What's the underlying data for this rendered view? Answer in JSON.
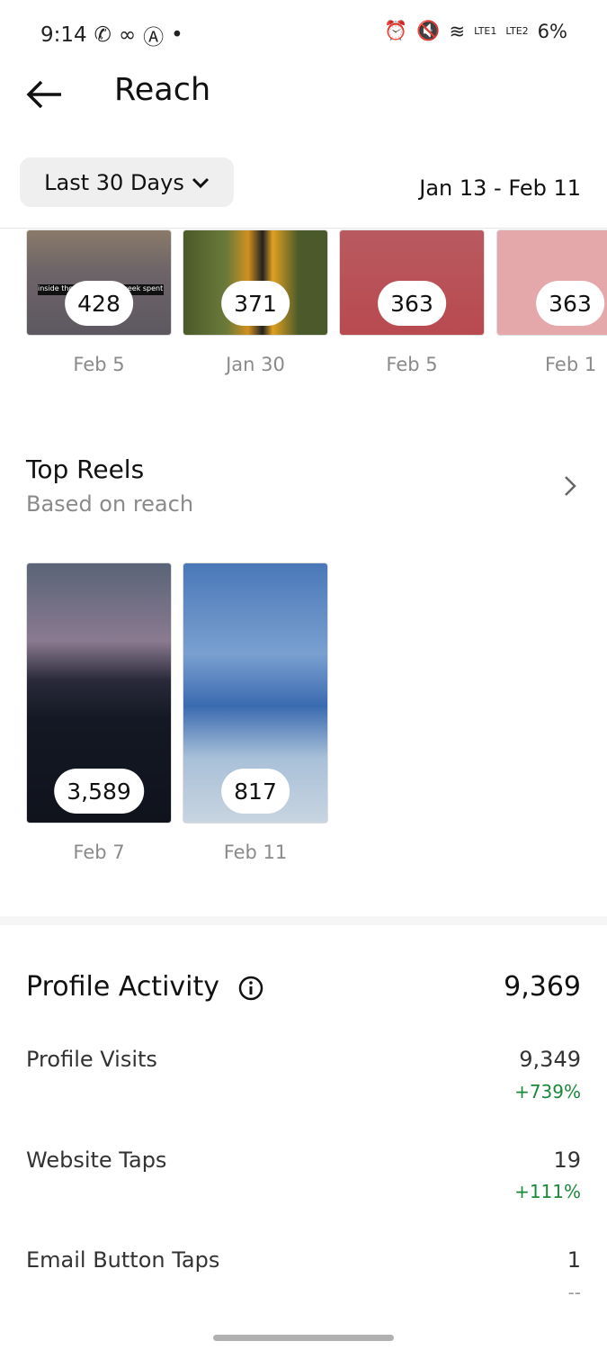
{
  "status_bar": {
    "time": "9:14",
    "battery": "6%",
    "network1": "LTE1",
    "network2": "LTE2"
  },
  "header": {
    "title": "Reach"
  },
  "filter": {
    "selected": "Last 30 Days",
    "date_range": "Jan 13 - Feb 11"
  },
  "top_posts": [
    {
      "value": "428",
      "date": "Feb 5",
      "caption": "inside thoughts after a week spent in hospitals ... the house"
    },
    {
      "value": "371",
      "date": "Jan 30"
    },
    {
      "value": "363",
      "date": "Feb 5"
    },
    {
      "value": "363",
      "date": "Feb 1"
    }
  ],
  "top_reels": {
    "title": "Top Reels",
    "subtitle": "Based on reach",
    "items": [
      {
        "value": "3,589",
        "date": "Feb 7"
      },
      {
        "value": "817",
        "date": "Feb 11"
      }
    ]
  },
  "profile_activity": {
    "title": "Profile Activity",
    "total": "9,369",
    "rows": [
      {
        "label": "Profile Visits",
        "value": "9,349",
        "change": "+739%"
      },
      {
        "label": "Website Taps",
        "value": "19",
        "change": "+111%"
      },
      {
        "label": "Email Button Taps",
        "value": "1",
        "change": "--"
      }
    ]
  },
  "colors": {
    "positive": "#1a8a3a",
    "muted": "#8a8a8a"
  }
}
